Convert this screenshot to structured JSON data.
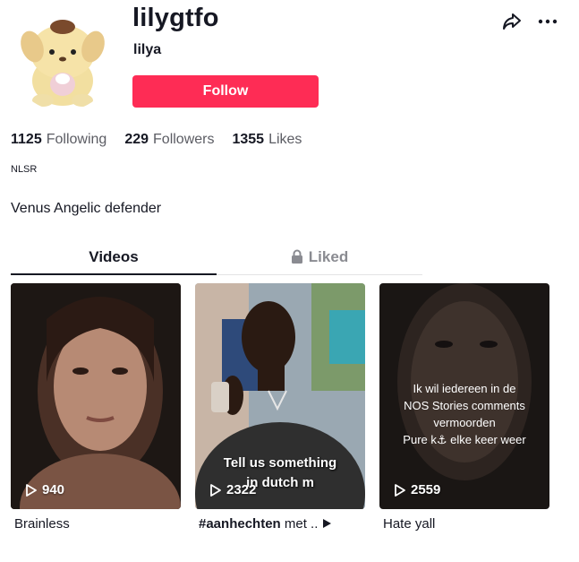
{
  "profile": {
    "username": "lilygtfo",
    "nickname": "lilya",
    "follow_label": "Follow",
    "tag": "NLSR",
    "bio": "Venus Angelic defender"
  },
  "stats": [
    {
      "value": "1125",
      "label": "Following"
    },
    {
      "value": "229",
      "label": "Followers"
    },
    {
      "value": "1355",
      "label": "Likes"
    }
  ],
  "tabs": [
    {
      "label": "Videos",
      "active": true
    },
    {
      "label": "Liked",
      "active": false,
      "icon": "lock-icon"
    }
  ],
  "videos": [
    {
      "views": "940",
      "caption": "Brainless",
      "overlay": ""
    },
    {
      "views": "2322",
      "caption_bold": "#aanhechten",
      "caption_rest": " met ..",
      "overlay_line1": "Tell us something",
      "overlay_line2": "in dutch m"
    },
    {
      "views": "2559",
      "caption": "Hate yall",
      "overlay_lines": [
        "Ik wil iedereen in de",
        "NOS Stories comments",
        "vermoorden",
        "Pure k⚓ elke keer weer"
      ]
    }
  ],
  "colors": {
    "accent": "#fe2c55",
    "text": "#161823",
    "muted": "#8a8b91"
  },
  "icons": [
    "share-icon",
    "more-icon",
    "lock-icon",
    "play-icon"
  ]
}
